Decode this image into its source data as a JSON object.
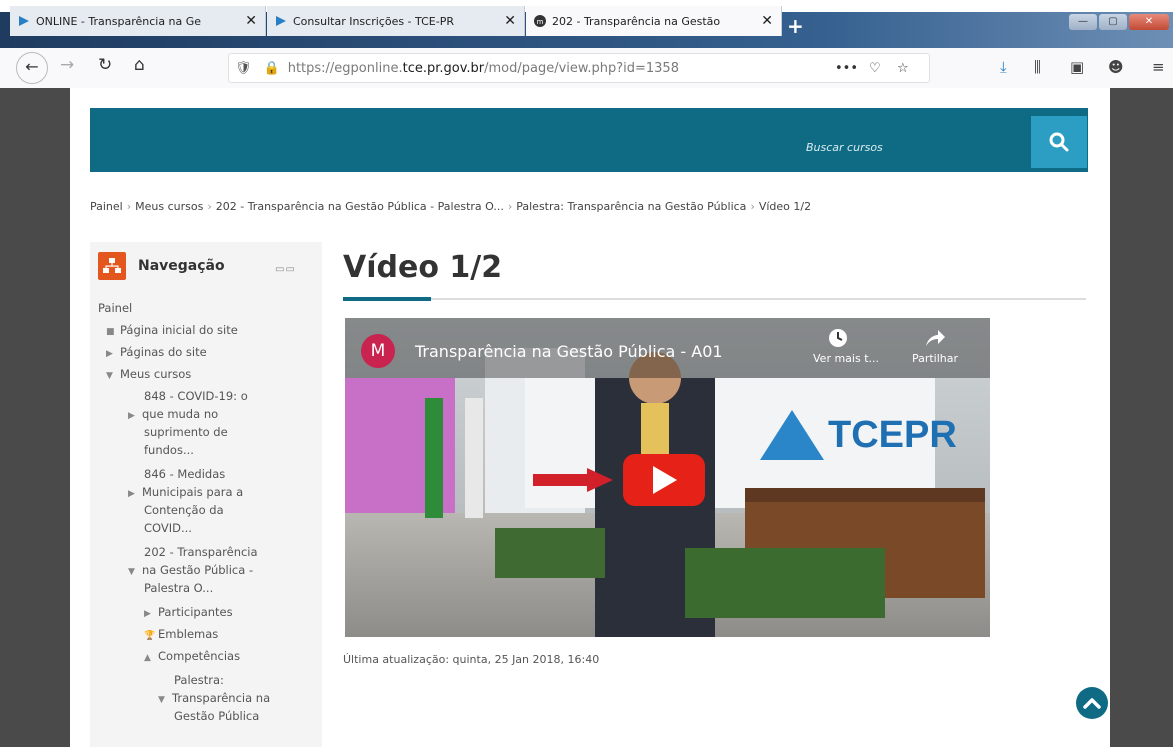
{
  "browser": {
    "tabs": [
      {
        "label": "ONLINE - Transparência na Ge",
        "active": false
      },
      {
        "label": "Consultar Inscrições - TCE-PR",
        "active": false
      },
      {
        "label": "202 - Transparência na Gestão",
        "active": true
      }
    ],
    "new_tab_label": "+",
    "close_glyph": "✕",
    "url_prefix": "https://egponline.",
    "url_domain": "tce.pr.gov.br",
    "url_path": "/mod/page/view.php?id=1358",
    "page_actions": "•••"
  },
  "site": {
    "search_placeholder": "Buscar cursos",
    "breadcrumb": [
      "Painel",
      "Meus cursos",
      "202 - Transparência na Gestão Pública - Palestra O...",
      "Palestra: Transparência na Gestão Pública",
      "Vídeo 1/2"
    ],
    "breadcrumb_sep": "›"
  },
  "navigation": {
    "title": "Navegação",
    "items": [
      {
        "text": "Painel",
        "bullet": ""
      },
      {
        "text": "Página inicial do site",
        "bullet": "■"
      },
      {
        "text": "Páginas do site",
        "bullet": "▶"
      },
      {
        "text": "Meus cursos",
        "bullet": "▼"
      },
      {
        "text": "848 - COVID-19: o",
        "bullet": ""
      },
      {
        "text": "que muda no",
        "bullet": "▶"
      },
      {
        "text": "suprimento de",
        "bullet": ""
      },
      {
        "text": "fundos...",
        "bullet": ""
      },
      {
        "text": "846 - Medidas",
        "bullet": ""
      },
      {
        "text": "Municipais para a",
        "bullet": "▶"
      },
      {
        "text": "Contenção da",
        "bullet": ""
      },
      {
        "text": "COVID...",
        "bullet": ""
      },
      {
        "text": "202 - Transparência",
        "bullet": ""
      },
      {
        "text": "na Gestão Pública -",
        "bullet": "▼"
      },
      {
        "text": "Palestra O...",
        "bullet": ""
      },
      {
        "text": "Participantes",
        "bullet": "▶"
      },
      {
        "text": "Emblemas",
        "bullet": "🏆"
      },
      {
        "text": "Competências",
        "bullet": "▲"
      },
      {
        "text": "Palestra:",
        "bullet": ""
      },
      {
        "text": "Transparência na",
        "bullet": "▼"
      },
      {
        "text": "Gestão Pública",
        "bullet": ""
      }
    ]
  },
  "main": {
    "title": "Vídeo 1/2",
    "video": {
      "channel_initial": "M",
      "title": "Transparência na Gestão Pública - A01",
      "watch_later": "Ver mais t...",
      "share": "Partilhar",
      "logo_text": "TCEPR"
    },
    "last_updated": "Última atualização: quinta, 25 Jan 2018, 16:40"
  },
  "colors": {
    "header": "#0f6a84",
    "search_button": "#2c9ec3",
    "nav_icon": "#e3561d",
    "play_button": "#e62117"
  }
}
